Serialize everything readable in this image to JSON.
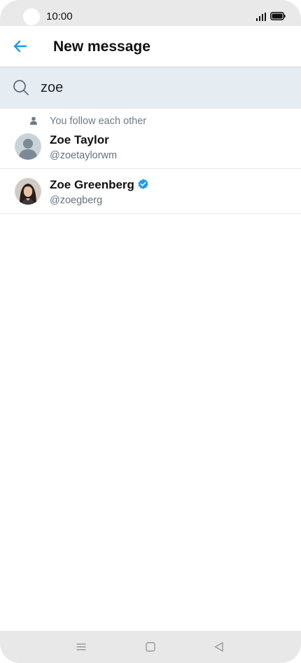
{
  "status_bar": {
    "time": "10:00",
    "icons": [
      "signal-icon",
      "battery-icon"
    ]
  },
  "header": {
    "title": "New message",
    "back_icon": "arrow-left-icon",
    "accent_color": "#1d9bf0"
  },
  "search": {
    "icon": "search-icon",
    "value": "zoe"
  },
  "results": [
    {
      "context_note": "You follow each other",
      "name": "Zoe Taylor",
      "handle": "@zoetaylorwm",
      "avatar": "default-avatar",
      "verified": false
    },
    {
      "name": "Zoe Greenberg",
      "handle": "@zoegberg",
      "avatar": "profile-photo",
      "verified": true
    }
  ],
  "nav_bar": {
    "icons": [
      "menu-icon",
      "home-square-icon",
      "back-triangle-icon"
    ]
  }
}
